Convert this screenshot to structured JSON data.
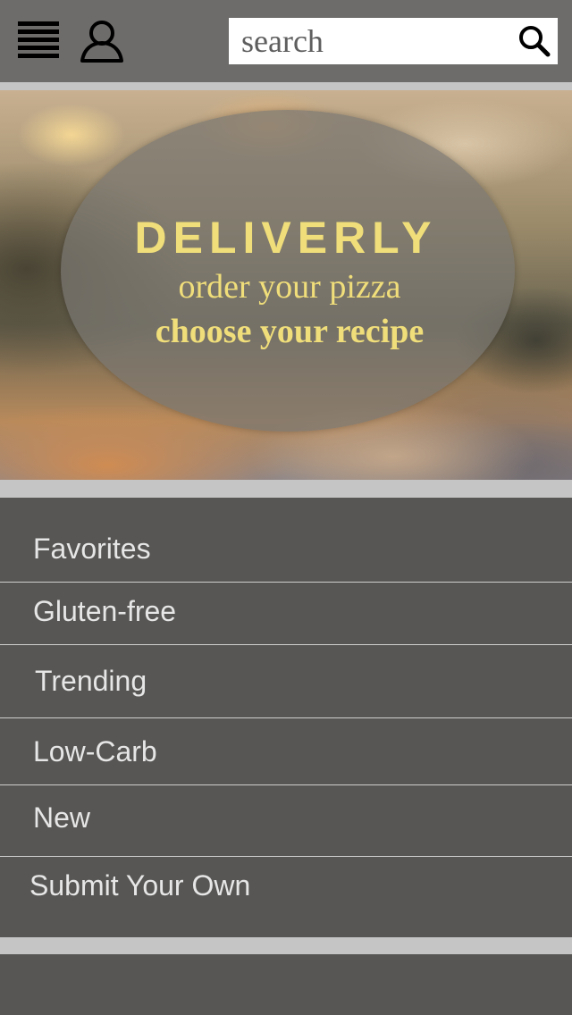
{
  "header": {
    "menu_icon": "hamburger-menu-icon",
    "user_icon": "user-profile-icon",
    "search": {
      "placeholder": "search",
      "value": ""
    },
    "search_icon": "magnifier-icon"
  },
  "hero": {
    "brand": "DELIVERLY",
    "tagline_line1": "order your pizza",
    "tagline_line2": "choose your recipe"
  },
  "menu": {
    "items": [
      {
        "label": "Favorites"
      },
      {
        "label": "Gluten-free"
      },
      {
        "label": "Trending"
      },
      {
        "label": "Low-Carb"
      },
      {
        "label": "New"
      },
      {
        "label": "Submit Your Own"
      }
    ]
  },
  "colors": {
    "header_bg": "#6d6c6a",
    "list_bg": "#575654",
    "accent_gold": "#f0de7a",
    "separator": "#c5c5c5"
  }
}
